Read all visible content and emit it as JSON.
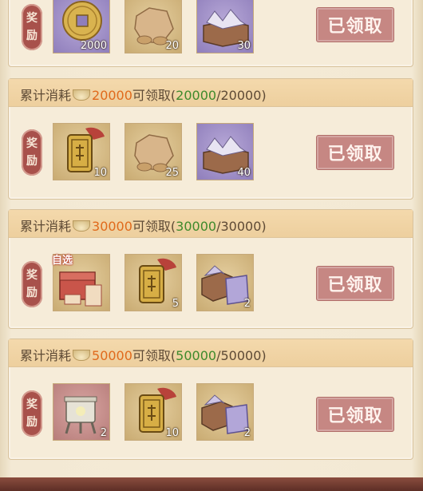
{
  "top_card": {
    "reward_label": [
      "奖",
      "励"
    ],
    "items": [
      {
        "icon": "copper-coin-icon",
        "qty": "2000"
      },
      {
        "icon": "rice-sack-icon",
        "qty": "20"
      },
      {
        "icon": "letter-box-icon",
        "qty": "30"
      }
    ],
    "button": "已领取"
  },
  "tiers": [
    {
      "head": {
        "prefix": "累计消耗",
        "target": "20000",
        "suffix": "可领取(",
        "progress": "20000",
        "total": "/20000)"
      },
      "reward_label": [
        "奖",
        "励"
      ],
      "items": [
        {
          "icon": "token-pendant-icon",
          "qty": "10"
        },
        {
          "icon": "rice-sack-icon",
          "qty": "25"
        },
        {
          "icon": "letter-box-icon",
          "qty": "40"
        }
      ],
      "button": "已领取"
    },
    {
      "head": {
        "prefix": "累计消耗",
        "target": "30000",
        "suffix": "可领取(",
        "progress": "30000",
        "total": "/30000)"
      },
      "reward_label": [
        "奖",
        "励"
      ],
      "items": [
        {
          "icon": "gift-chest-icon",
          "qty": "",
          "tag": "自选"
        },
        {
          "icon": "token-pendant-icon",
          "qty": "5"
        },
        {
          "icon": "letter-box-icon",
          "qty": "2"
        }
      ],
      "button": "已领取"
    },
    {
      "head": {
        "prefix": "累计消耗",
        "target": "50000",
        "suffix": "可领取(",
        "progress": "50000",
        "total": "/50000)"
      },
      "reward_label": [
        "奖",
        "励"
      ],
      "items": [
        {
          "icon": "bronze-cauldron-icon",
          "qty": "2"
        },
        {
          "icon": "token-pendant-icon",
          "qty": "10"
        },
        {
          "icon": "letter-box-icon",
          "qty": "2"
        }
      ],
      "button": "已领取"
    }
  ]
}
